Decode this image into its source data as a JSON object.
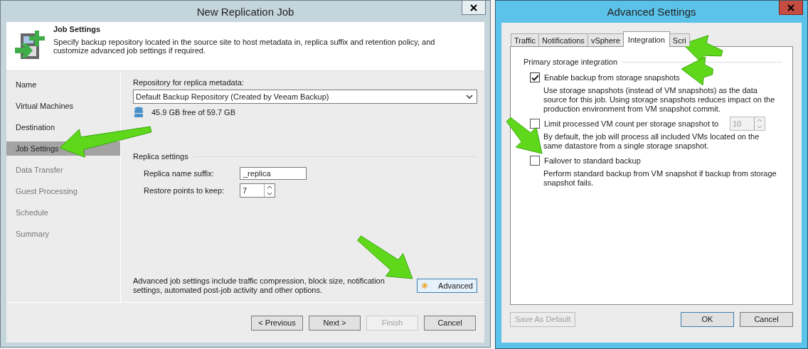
{
  "wizard": {
    "title": "New Replication Job",
    "header": {
      "title": "Job Settings",
      "description": "Specify backup repository located in the source site to host metadata in, replica suffix and retention policy, and customize advanced job settings if required."
    },
    "steps": [
      {
        "label": "Name",
        "selected": false,
        "disabled": false
      },
      {
        "label": "Virtual Machines",
        "selected": false,
        "disabled": false
      },
      {
        "label": "Destination",
        "selected": false,
        "disabled": false
      },
      {
        "label": "Job Settings",
        "selected": true,
        "disabled": false
      },
      {
        "label": "Data Transfer",
        "selected": false,
        "disabled": true
      },
      {
        "label": "Guest Processing",
        "selected": false,
        "disabled": true
      },
      {
        "label": "Schedule",
        "selected": false,
        "disabled": true
      },
      {
        "label": "Summary",
        "selected": false,
        "disabled": true
      }
    ],
    "repository": {
      "label": "Repository for replica metadata:",
      "value": "Default Backup Repository (Created by Veeam Backup)",
      "free_space": "45.9 GB free of 59.7 GB"
    },
    "replica_settings": {
      "title": "Replica settings",
      "suffix_label": "Replica name suffix:",
      "suffix_value": "_replica",
      "restore_label": "Restore points to keep:",
      "restore_value": "7"
    },
    "advanced_note": "Advanced job settings include traffic compression, block size, notification settings, automated post-job activity and other options.",
    "advanced_button": "Advanced",
    "buttons": [
      {
        "label": "< Previous",
        "disabled": false
      },
      {
        "label": "Next >",
        "disabled": false
      },
      {
        "label": "Finish",
        "disabled": true
      },
      {
        "label": "Cancel",
        "disabled": false
      }
    ]
  },
  "advanced": {
    "title": "Advanced Settings",
    "tabs": [
      {
        "label": "Traffic",
        "selected": false
      },
      {
        "label": "Notifications",
        "selected": false
      },
      {
        "label": "vSphere",
        "selected": false
      },
      {
        "label": "Integration",
        "selected": true
      },
      {
        "label": "Scri",
        "selected": false
      }
    ],
    "group_title": "Primary storage integration",
    "options": [
      {
        "kind": "checkbox",
        "label": "Enable backup from storage snapshots",
        "checked": true,
        "description": "Use storage snapshots (instead of VM snapshots) as the data source for this job. Using storage snapshots reduces impact on the production environment from VM snapshot commit."
      },
      {
        "kind": "checkbox-spinner",
        "label": "Limit processed VM count per storage snapshot to",
        "checked": false,
        "spinner_value": "10",
        "description": "By default, the job will process all included VMs located on the same datastore from a single storage snapshot."
      },
      {
        "kind": "checkbox",
        "label": "Failover to standard backup",
        "checked": false,
        "description": "Perform standard backup from VM snapshot if backup from storage snapshot fails."
      }
    ],
    "buttons": [
      {
        "label": "Save As Default",
        "disabled": true,
        "default": false
      },
      {
        "label": "OK",
        "disabled": false,
        "default": true
      },
      {
        "label": "Cancel",
        "disabled": false,
        "default": false
      }
    ]
  }
}
